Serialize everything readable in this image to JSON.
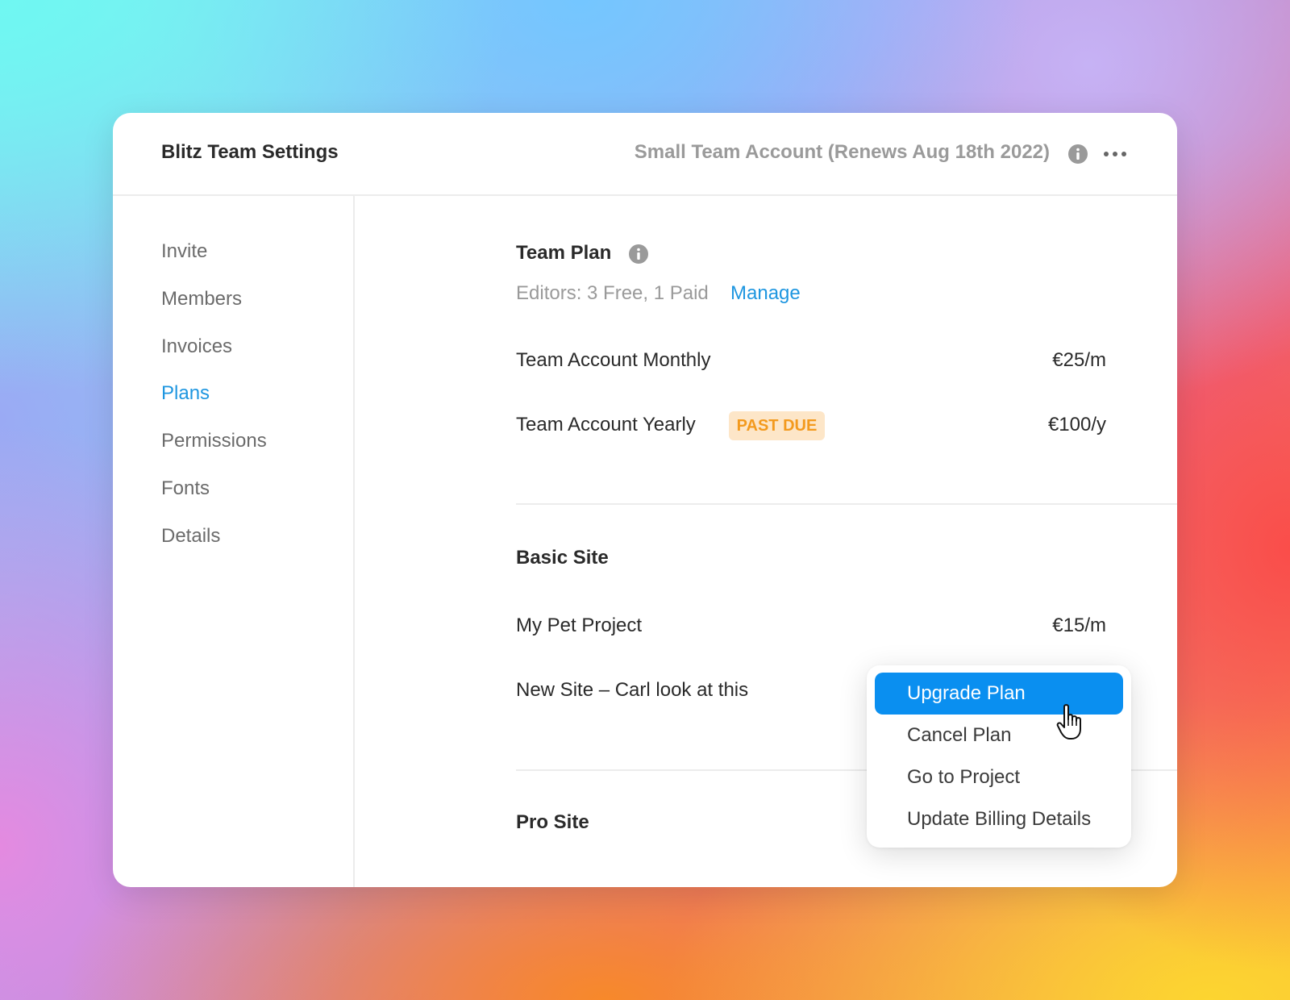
{
  "header": {
    "title": "Blitz Team Settings",
    "account_info": "Small Team Account (Renews Aug 18th 2022)"
  },
  "sidebar": {
    "items": [
      {
        "label": "Invite"
      },
      {
        "label": "Members"
      },
      {
        "label": "Invoices"
      },
      {
        "label": "Plans",
        "active": true
      },
      {
        "label": "Permissions"
      },
      {
        "label": "Fonts"
      },
      {
        "label": "Details"
      }
    ]
  },
  "team_plan": {
    "title": "Team Plan",
    "editors": "Editors: 3 Free, 1 Paid",
    "manage_label": "Manage",
    "rows": [
      {
        "label": "Team Account Monthly",
        "price": "€25/m"
      },
      {
        "label": "Team Account Yearly",
        "badge": "PAST DUE",
        "price": "€100/y"
      }
    ]
  },
  "basic_site": {
    "title": "Basic Site",
    "rows": [
      {
        "label": "My Pet Project",
        "price": "€15/m"
      },
      {
        "label": "New Site – Carl look at this"
      }
    ]
  },
  "pro_site": {
    "title": "Pro Site"
  },
  "dropdown_menu": {
    "items": [
      {
        "label": "Upgrade Plan",
        "highlighted": true
      },
      {
        "label": "Cancel Plan"
      },
      {
        "label": "Go to Project"
      },
      {
        "label": "Update Billing Details"
      }
    ]
  },
  "colors": {
    "accent": "#1e96e0",
    "menu_highlight": "#0a8ff0",
    "badge_bg": "#fde6c8",
    "badge_text": "#f39a1e"
  },
  "icons": [
    "info-icon",
    "more-horizontal-icon",
    "hand-cursor-icon"
  ]
}
